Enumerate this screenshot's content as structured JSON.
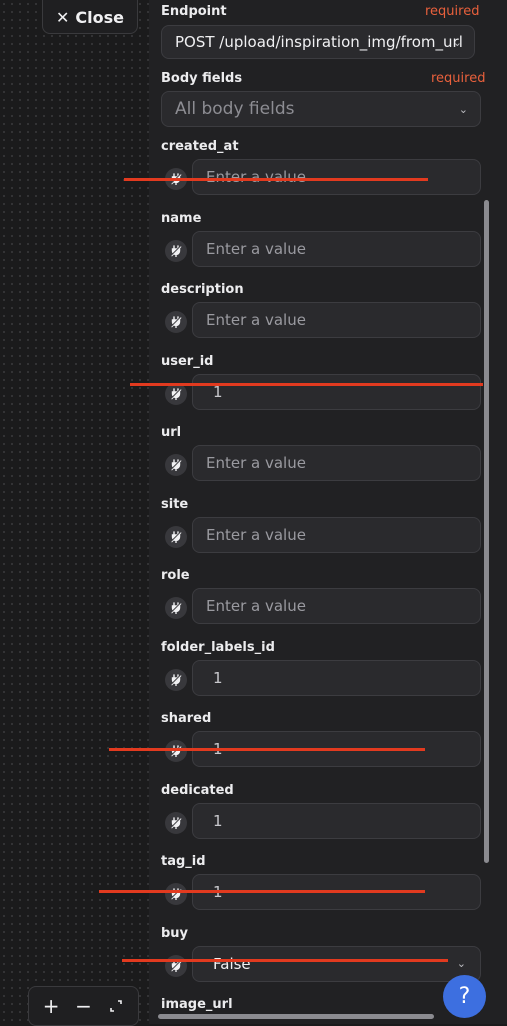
{
  "close_button": {
    "label": "Close"
  },
  "zoom_bar": {
    "zoom_in": "+",
    "zoom_out": "−"
  },
  "panel": {
    "endpoint": {
      "label": "Endpoint",
      "required": "required",
      "value": "POST /upload/inspiration_img/from_url"
    },
    "body_fields": {
      "label": "Body fields",
      "required": "required",
      "placeholder": "All body fields"
    },
    "fields": [
      {
        "label": "created_at",
        "placeholder": "Enter a value",
        "value": ""
      },
      {
        "label": "name",
        "placeholder": "Enter a value",
        "value": ""
      },
      {
        "label": "description",
        "placeholder": "Enter a value",
        "value": ""
      },
      {
        "label": "user_id",
        "placeholder": "",
        "value": "1"
      },
      {
        "label": "url",
        "placeholder": "Enter a value",
        "value": ""
      },
      {
        "label": "site",
        "placeholder": "Enter a value",
        "value": ""
      },
      {
        "label": "role",
        "placeholder": "Enter a value",
        "value": ""
      },
      {
        "label": "folder_labels_id",
        "placeholder": "",
        "value": "1"
      },
      {
        "label": "shared",
        "placeholder": "",
        "value": "1"
      },
      {
        "label": "dedicated",
        "placeholder": "",
        "value": "1"
      },
      {
        "label": "tag_id",
        "placeholder": "",
        "value": "1"
      },
      {
        "label": "buy",
        "placeholder": "",
        "value": "False"
      },
      {
        "label": "image_url",
        "placeholder": "",
        "value": ""
      }
    ]
  },
  "help_button": {
    "label": "?"
  },
  "colors": {
    "accent": "#3d6fe0",
    "required": "#e8603c",
    "strike": "#e23a1f",
    "panel": "#212123"
  }
}
